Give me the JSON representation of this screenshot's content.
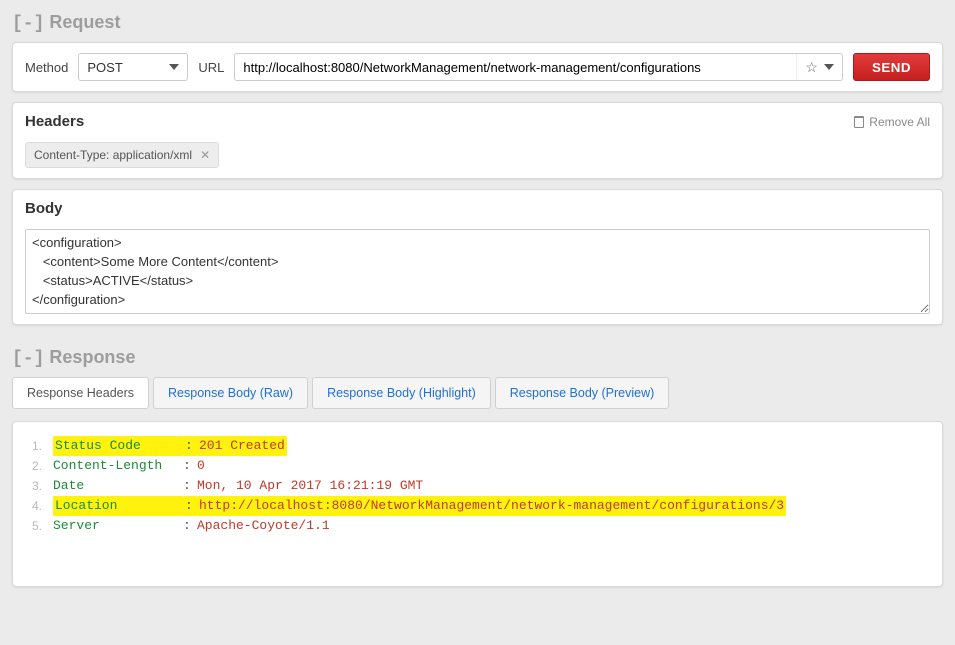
{
  "request": {
    "title_prefix": "[-]",
    "title": "Request",
    "method_label": "Method",
    "method_value": "POST",
    "url_label": "URL",
    "url_value": "http://localhost:8080/NetworkManagement/network-management/configurations",
    "send_label": "SEND"
  },
  "headers": {
    "title": "Headers",
    "remove_all": "Remove All",
    "tag": "Content-Type: application/xml"
  },
  "body": {
    "title": "Body",
    "content": "<configuration>\n   <content>Some More Content</content>\n   <status>ACTIVE</status>\n</configuration>"
  },
  "response": {
    "title_prefix": "[-]",
    "title": "Response",
    "tabs": {
      "headers": "Response Headers",
      "raw": "Response Body (Raw)",
      "highlight": "Response Body (Highlight)",
      "preview": "Response Body (Preview)"
    },
    "lines": {
      "l1": {
        "num": "1.",
        "key": "Status Code",
        "val": "201 Created",
        "hl": true
      },
      "l2": {
        "num": "2.",
        "key": "Content-Length",
        "val": "0",
        "hl": false
      },
      "l3": {
        "num": "3.",
        "key": "Date",
        "val": "Mon, 10 Apr 2017 16:21:19 GMT",
        "hl": false
      },
      "l4": {
        "num": "4.",
        "key": "Location",
        "val": "http://localhost:8080/NetworkManagement/network-management/configurations/3",
        "hl": true
      },
      "l5": {
        "num": "5.",
        "key": "Server",
        "val": "Apache-Coyote/1.1",
        "hl": false
      }
    }
  }
}
